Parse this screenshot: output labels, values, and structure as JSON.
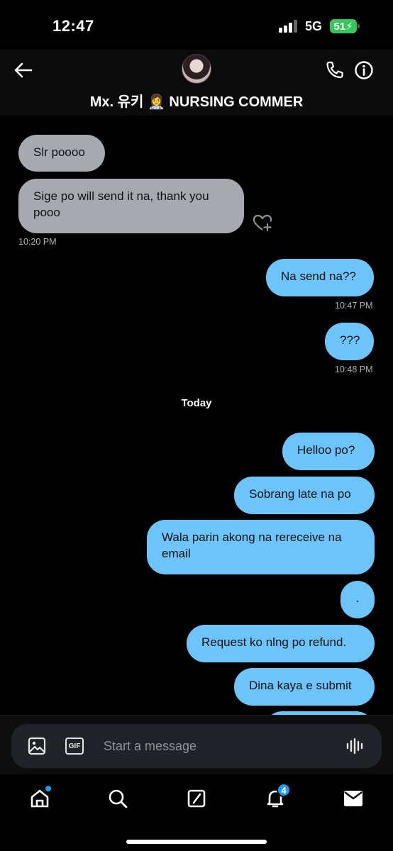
{
  "status_bar": {
    "time": "12:47",
    "network": "5G",
    "battery": "51"
  },
  "header": {
    "contact_name": "Mx. 유키 👩‍⚕️ NURSING COMMER"
  },
  "messages": [
    {
      "text": "Slr poooo",
      "direction": "incoming"
    },
    {
      "text": "Sige po will send it na, thank you pooo",
      "direction": "incoming",
      "timestamp": "10:20 PM"
    },
    {
      "text": "Na send na??",
      "direction": "outgoing",
      "timestamp": "10:47 PM"
    },
    {
      "text": "???",
      "direction": "outgoing",
      "timestamp": "10:48 PM"
    },
    {
      "text": "Helloo po?",
      "direction": "outgoing"
    },
    {
      "text": "Sobrang late na po",
      "direction": "outgoing"
    },
    {
      "text": "Wala parin akong na rereceive na email",
      "direction": "outgoing"
    },
    {
      "text": ".",
      "direction": "outgoing"
    },
    {
      "text": "Request ko nlng po refund.",
      "direction": "outgoing"
    },
    {
      "text": "Dina kaya e submit",
      "direction": "outgoing"
    }
  ],
  "day_separator": "Today",
  "composer": {
    "placeholder": "Start a message",
    "gif_label": "GIF"
  },
  "nav": {
    "notifications_badge": "4"
  },
  "colors": {
    "incoming_bubble": "#a6aab0",
    "outgoing_bubble": "#6cc4fb",
    "accent": "#1d9bf0",
    "battery": "#34c759"
  },
  "icons": [
    "back-arrow-icon",
    "phone-icon",
    "info-icon",
    "heart-plus-icon",
    "image-icon",
    "gif-icon",
    "voice-icon",
    "home-icon",
    "search-icon",
    "compose-icon",
    "bell-icon",
    "mail-icon"
  ]
}
